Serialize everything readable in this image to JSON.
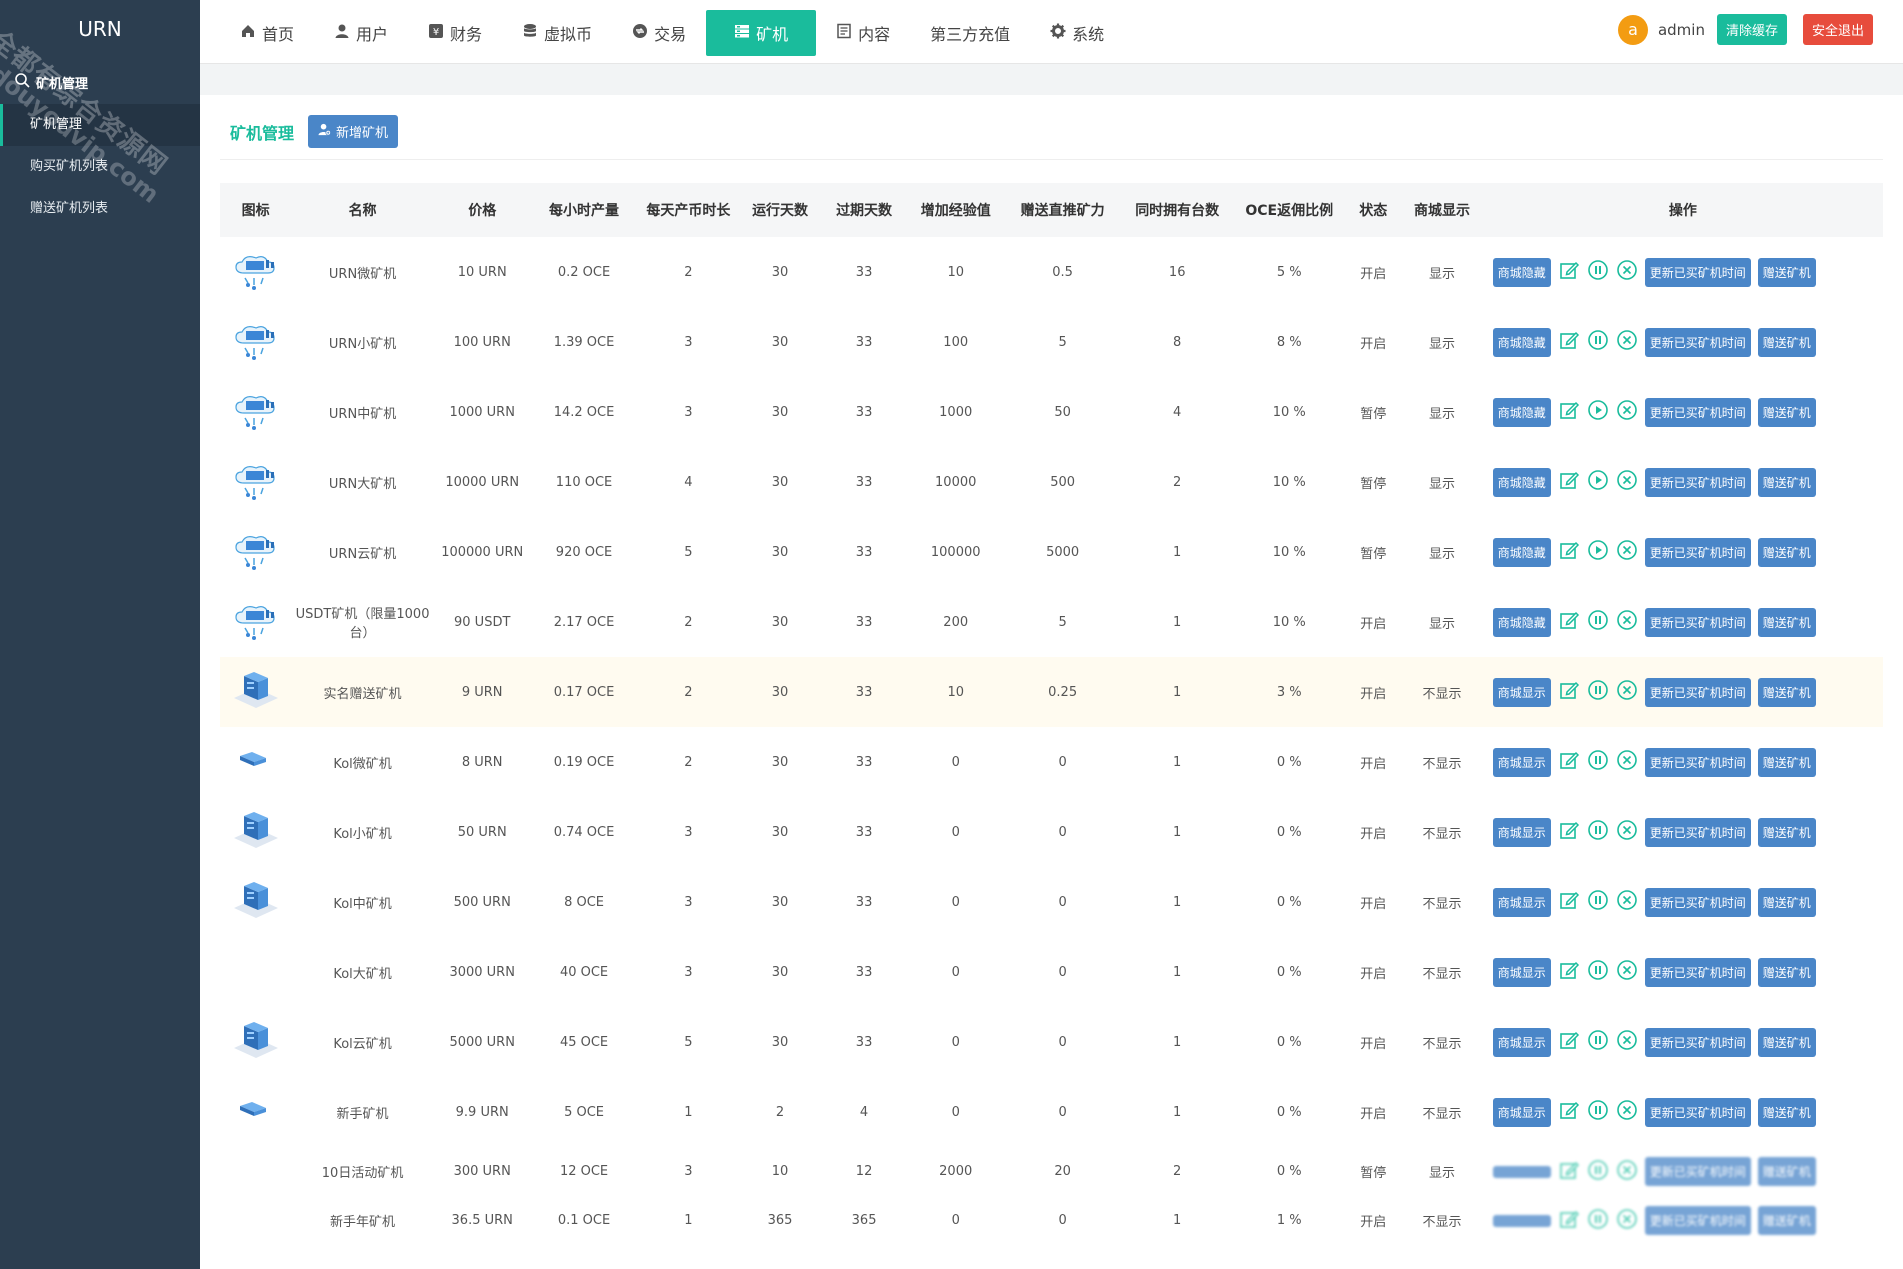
{
  "sidebar": {
    "brand": "URN",
    "section": "矿机管理",
    "items": [
      "矿机管理",
      "购买矿机列表",
      "赠送矿机列表"
    ]
  },
  "watermark": {
    "line1": "全都有综合资源网",
    "line2": "douyouvip.com"
  },
  "nav": {
    "items": [
      "首页",
      "用户",
      "财务",
      "虚拟币",
      "交易",
      "矿机",
      "内容",
      "第三方充值",
      "系统"
    ],
    "active": "矿机"
  },
  "header": {
    "avatar_letter": "a",
    "username": "admin",
    "clear_cache": "清除缓存",
    "logout": "安全退出"
  },
  "page": {
    "title": "矿机管理",
    "add_button": "新增矿机"
  },
  "table": {
    "headers": [
      "图标",
      "名称",
      "价格",
      "每小时产量",
      "每天产币时长",
      "运行天数",
      "过期天数",
      "增加经验值",
      "赠送直推矿力",
      "同时拥有台数",
      "OCE返佣比例",
      "状态",
      "商城显示",
      "操作"
    ],
    "rows": [
      {
        "icon": "cloud",
        "name": "URN微矿机",
        "price": "10 URN",
        "hourly": "0.2 OCE",
        "daily": "2",
        "run": "30",
        "expire": "33",
        "exp": "10",
        "power": "0.5",
        "own": "16",
        "rebate": "5 %",
        "status": "开启",
        "show": "显示",
        "shop_btn": "商城隐藏",
        "state": "pause"
      },
      {
        "icon": "cloud",
        "name": "URN小矿机",
        "price": "100 URN",
        "hourly": "1.39 OCE",
        "daily": "3",
        "run": "30",
        "expire": "33",
        "exp": "100",
        "power": "5",
        "own": "8",
        "rebate": "8 %",
        "status": "开启",
        "show": "显示",
        "shop_btn": "商城隐藏",
        "state": "pause"
      },
      {
        "icon": "cloud",
        "name": "URN中矿机",
        "price": "1000 URN",
        "hourly": "14.2 OCE",
        "daily": "3",
        "run": "30",
        "expire": "33",
        "exp": "1000",
        "power": "50",
        "own": "4",
        "rebate": "10 %",
        "status": "暂停",
        "show": "显示",
        "shop_btn": "商城隐藏",
        "state": "play"
      },
      {
        "icon": "cloud",
        "name": "URN大矿机",
        "price": "10000 URN",
        "hourly": "110 OCE",
        "daily": "4",
        "run": "30",
        "expire": "33",
        "exp": "10000",
        "power": "500",
        "own": "2",
        "rebate": "10 %",
        "status": "暂停",
        "show": "显示",
        "shop_btn": "商城隐藏",
        "state": "play"
      },
      {
        "icon": "cloud",
        "name": "URN云矿机",
        "price": "100000 URN",
        "hourly": "920 OCE",
        "daily": "5",
        "run": "30",
        "expire": "33",
        "exp": "100000",
        "power": "5000",
        "own": "1",
        "rebate": "10 %",
        "status": "暂停",
        "show": "显示",
        "shop_btn": "商城隐藏",
        "state": "play"
      },
      {
        "icon": "cloud",
        "name": "USDT矿机（限量1000台）",
        "price": "90 USDT",
        "hourly": "2.17 OCE",
        "daily": "2",
        "run": "30",
        "expire": "33",
        "exp": "200",
        "power": "5",
        "own": "1",
        "rebate": "10 %",
        "status": "开启",
        "show": "显示",
        "shop_btn": "商城隐藏",
        "state": "pause"
      },
      {
        "icon": "server",
        "name": "实名赠送矿机",
        "price": "9 URN",
        "hourly": "0.17 OCE",
        "daily": "2",
        "run": "30",
        "expire": "33",
        "exp": "10",
        "power": "0.25",
        "own": "1",
        "rebate": "3 %",
        "status": "开启",
        "show": "不显示",
        "shop_btn": "商城显示",
        "state": "pause"
      },
      {
        "icon": "server-small",
        "name": "Kol微矿机",
        "price": "8 URN",
        "hourly": "0.19 OCE",
        "daily": "2",
        "run": "30",
        "expire": "33",
        "exp": "0",
        "power": "0",
        "own": "1",
        "rebate": "0 %",
        "status": "开启",
        "show": "不显示",
        "shop_btn": "商城显示",
        "state": "pause"
      },
      {
        "icon": "server",
        "name": "Kol小矿机",
        "price": "50 URN",
        "hourly": "0.74 OCE",
        "daily": "3",
        "run": "30",
        "expire": "33",
        "exp": "0",
        "power": "0",
        "own": "1",
        "rebate": "0 %",
        "status": "开启",
        "show": "不显示",
        "shop_btn": "商城显示",
        "state": "pause"
      },
      {
        "icon": "server",
        "name": "Kol中矿机",
        "price": "500 URN",
        "hourly": "8 OCE",
        "daily": "3",
        "run": "30",
        "expire": "33",
        "exp": "0",
        "power": "0",
        "own": "1",
        "rebate": "0 %",
        "status": "开启",
        "show": "不显示",
        "shop_btn": "商城显示",
        "state": "pause"
      },
      {
        "icon": "none",
        "name": "Kol大矿机",
        "price": "3000 URN",
        "hourly": "40 OCE",
        "daily": "3",
        "run": "30",
        "expire": "33",
        "exp": "0",
        "power": "0",
        "own": "1",
        "rebate": "0 %",
        "status": "开启",
        "show": "不显示",
        "shop_btn": "商城显示",
        "state": "pause"
      },
      {
        "icon": "server",
        "name": "Kol云矿机",
        "price": "5000 URN",
        "hourly": "45 OCE",
        "daily": "5",
        "run": "30",
        "expire": "33",
        "exp": "0",
        "power": "0",
        "own": "1",
        "rebate": "0 %",
        "status": "开启",
        "show": "不显示",
        "shop_btn": "商城显示",
        "state": "pause"
      },
      {
        "icon": "server-small",
        "name": "新手矿机",
        "price": "9.9 URN",
        "hourly": "5 OCE",
        "daily": "1",
        "run": "2",
        "expire": "4",
        "exp": "0",
        "power": "0",
        "own": "1",
        "rebate": "0 %",
        "status": "开启",
        "show": "不显示",
        "shop_btn": "商城显示",
        "state": "pause"
      },
      {
        "icon": "none",
        "name": "10日活动矿机",
        "price": "300 URN",
        "hourly": "12 OCE",
        "daily": "3",
        "run": "10",
        "expire": "12",
        "exp": "2000",
        "power": "20",
        "own": "2",
        "rebate": "0 %",
        "status": "暂停",
        "show": "显示",
        "shop_btn": "",
        "state": "blur"
      },
      {
        "icon": "none",
        "name": "新手年矿机",
        "price": "36.5 URN",
        "hourly": "0.1 OCE",
        "daily": "1",
        "run": "365",
        "expire": "365",
        "exp": "0",
        "power": "0",
        "own": "1",
        "rebate": "1 %",
        "status": "开启",
        "show": "不显示",
        "shop_btn": "",
        "state": "blur"
      }
    ],
    "update_btn": "更新已买矿机时间",
    "gift_btn": "赠送矿机"
  },
  "colors": {
    "accent": "#1abc9c",
    "sidebar": "#2c3e50",
    "button_blue": "#4a86c8",
    "danger": "#e74c3c",
    "avatar": "#f39c12"
  }
}
